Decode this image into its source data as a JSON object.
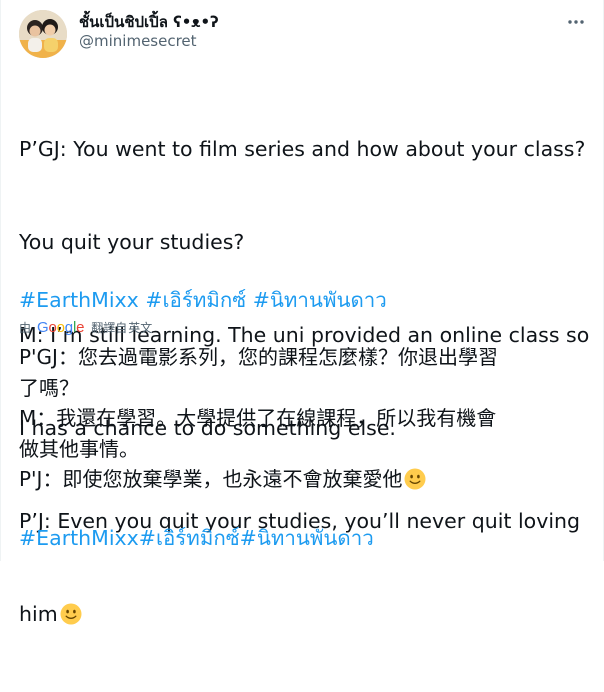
{
  "author": {
    "display_name": "ชั้นเป็นชิปเปิ้ล ʕ•ᴥ•ʔ",
    "handle": "@minimesecret"
  },
  "tweet": {
    "lines": [
      "P’GJ: You went to film series and how about your class?",
      "You quit your studies?",
      "M: I’m still learning. The uni provided an online class so",
      "I has a chance to do something else.",
      "P’J: Even you quit your studies, you’ll never quit loving",
      "him"
    ],
    "hashtags": [
      "#EarthMixx",
      "#เอิร์ทมิกซ์",
      "#นิทานพันดาว"
    ]
  },
  "translation": {
    "by_label": "由",
    "provider": "Google",
    "translated_label": "翻譯自",
    "source_language": "英文",
    "lines": [
      "P'GJ：您去過電影系列，您的課程怎麼樣？你退出學習",
      "了嗎？",
      " M：我還在學習。大學提供了在線課程，所以我有機會",
      "做其他事情。",
      " P'J：即使您放棄學業，也永遠不會放棄愛他"
    ],
    "hashtags_text": "#EarthMixx#เอิร์ทมิกซ์#นิทานพันดาว"
  },
  "icons": {
    "more": "more-horizontal-icon",
    "emoji": "slightly-smiling-face-icon"
  },
  "colors": {
    "link": "#1d9bf0",
    "secondary_text": "#536471",
    "primary_text": "#0f1419"
  }
}
